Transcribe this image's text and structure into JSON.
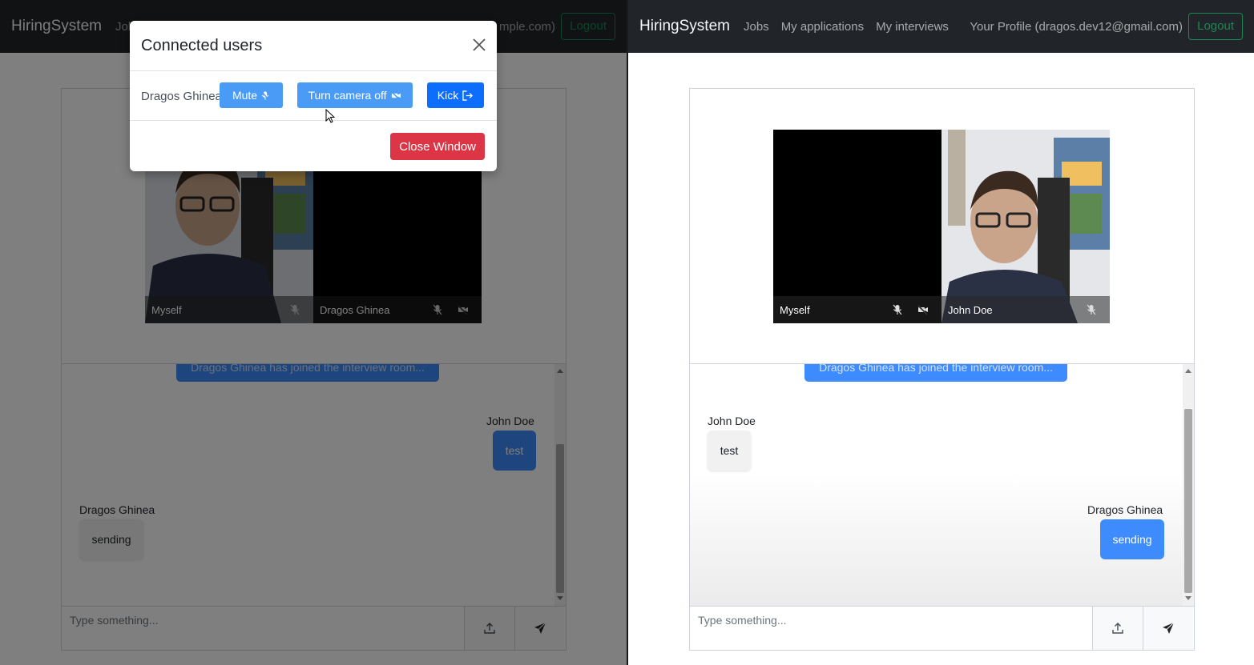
{
  "left": {
    "navbar": {
      "brand": "HiringSystem",
      "links": [
        "Jobs"
      ],
      "profile_text": "mple.com)",
      "logout_label": "Logout"
    },
    "video": {
      "tiles": [
        {
          "name": "Myself",
          "icons": [
            "mic-off-icon"
          ]
        },
        {
          "name": "Dragos Ghinea",
          "icons": [
            "mic-off-icon",
            "camera-off-icon"
          ]
        }
      ]
    },
    "chat": {
      "system_message": "Dragos Ghinea has joined the interview room...",
      "messages": [
        {
          "sender": "John Doe",
          "text": "test",
          "mine": true
        },
        {
          "sender": "Dragos Ghinea",
          "text": "sending",
          "mine": false
        }
      ]
    },
    "input": {
      "placeholder": "Type something..."
    },
    "modal": {
      "title": "Connected users",
      "user_name": "Dragos Ghinea",
      "mute_label": "Mute",
      "camera_label": "Turn camera off",
      "kick_label": "Kick",
      "close_label": "Close Window"
    }
  },
  "right": {
    "navbar": {
      "brand": "HiringSystem",
      "links": [
        "Jobs",
        "My applications",
        "My interviews"
      ],
      "profile_text": "Your Profile (dragos.dev12@gmail.com)",
      "logout_label": "Logout"
    },
    "video": {
      "tiles": [
        {
          "name": "Myself",
          "icons": [
            "mic-off-icon",
            "camera-off-icon"
          ]
        },
        {
          "name": "John Doe",
          "icons": [
            "mic-off-icon"
          ]
        }
      ]
    },
    "chat": {
      "system_message": "Dragos Ghinea has joined the interview room...",
      "messages": [
        {
          "sender": "John Doe",
          "text": "test",
          "mine": false
        },
        {
          "sender": "Dragos Ghinea",
          "text": "sending",
          "mine": true
        }
      ]
    },
    "input": {
      "placeholder": "Type something..."
    }
  },
  "colors": {
    "navbar": "#212529",
    "primary": "#3d8bfd",
    "modal_button": "#4a9bf5",
    "kick_button": "#0d6efd",
    "danger": "#dc3545",
    "success": "#198754"
  }
}
